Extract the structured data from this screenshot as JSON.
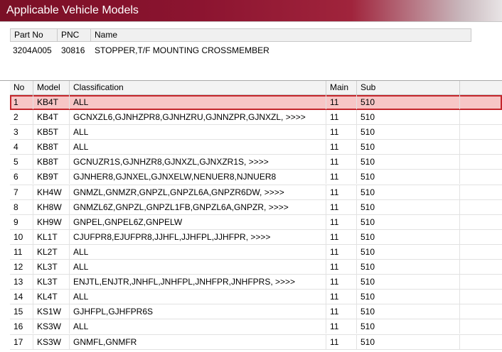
{
  "window": {
    "title": "Applicable Vehicle Models"
  },
  "part_table": {
    "headers": {
      "part_no": "Part No",
      "pnc": "PNC",
      "name": "Name"
    },
    "row": {
      "part_no": "3204A005",
      "pnc": "30816",
      "name": "STOPPER,T/F MOUNTING CROSSMEMBER"
    }
  },
  "models_table": {
    "headers": {
      "no": "No",
      "model": "Model",
      "classification": "Classification",
      "main": "Main",
      "sub": "Sub"
    },
    "rows": [
      {
        "no": "1",
        "model": "KB4T",
        "classification": "ALL",
        "main": "11",
        "sub": "510"
      },
      {
        "no": "2",
        "model": "KB4T",
        "classification": "GCNXZL6,GJNHZPR8,GJNHZRU,GJNNZPR,GJNXZL,  >>>>",
        "main": "11",
        "sub": "510"
      },
      {
        "no": "3",
        "model": "KB5T",
        "classification": "ALL",
        "main": "11",
        "sub": "510"
      },
      {
        "no": "4",
        "model": "KB8T",
        "classification": "ALL",
        "main": "11",
        "sub": "510"
      },
      {
        "no": "5",
        "model": "KB8T",
        "classification": "GCNUZR1S,GJNHZR8,GJNXZL,GJNXZR1S,  >>>>",
        "main": "11",
        "sub": "510"
      },
      {
        "no": "6",
        "model": "KB9T",
        "classification": "GJNHER8,GJNXEL,GJNXELW,NENUER8,NJNUER8",
        "main": "11",
        "sub": "510"
      },
      {
        "no": "7",
        "model": "KH4W",
        "classification": "GNMZL,GNMZR,GNPZL,GNPZL6A,GNPZR6DW,  >>>>",
        "main": "11",
        "sub": "510"
      },
      {
        "no": "8",
        "model": "KH8W",
        "classification": "GNMZL6Z,GNPZL,GNPZL1FB,GNPZL6A,GNPZR,  >>>>",
        "main": "11",
        "sub": "510"
      },
      {
        "no": "9",
        "model": "KH9W",
        "classification": "GNPEL,GNPEL6Z,GNPELW",
        "main": "11",
        "sub": "510"
      },
      {
        "no": "10",
        "model": "KL1T",
        "classification": "CJUFPR8,EJUFPR8,JJHFL,JJHFPL,JJHFPR,  >>>>",
        "main": "11",
        "sub": "510"
      },
      {
        "no": "11",
        "model": "KL2T",
        "classification": "ALL",
        "main": "11",
        "sub": "510"
      },
      {
        "no": "12",
        "model": "KL3T",
        "classification": "ALL",
        "main": "11",
        "sub": "510"
      },
      {
        "no": "13",
        "model": "KL3T",
        "classification": "ENJTL,ENJTR,JNHFL,JNHFPL,JNHFPR,JNHFPRS,  >>>>",
        "main": "11",
        "sub": "510"
      },
      {
        "no": "14",
        "model": "KL4T",
        "classification": "ALL",
        "main": "11",
        "sub": "510"
      },
      {
        "no": "15",
        "model": "KS1W",
        "classification": "GJHFPL,GJHFPR6S",
        "main": "11",
        "sub": "510"
      },
      {
        "no": "16",
        "model": "KS3W",
        "classification": "ALL",
        "main": "11",
        "sub": "510"
      },
      {
        "no": "17",
        "model": "KS3W",
        "classification": "GNMFL,GNMFR",
        "main": "11",
        "sub": "510"
      }
    ]
  },
  "colors": {
    "titlebar": "#8c1430",
    "selection_fill": "#f7c6c6",
    "selection_border": "#c4262c"
  }
}
